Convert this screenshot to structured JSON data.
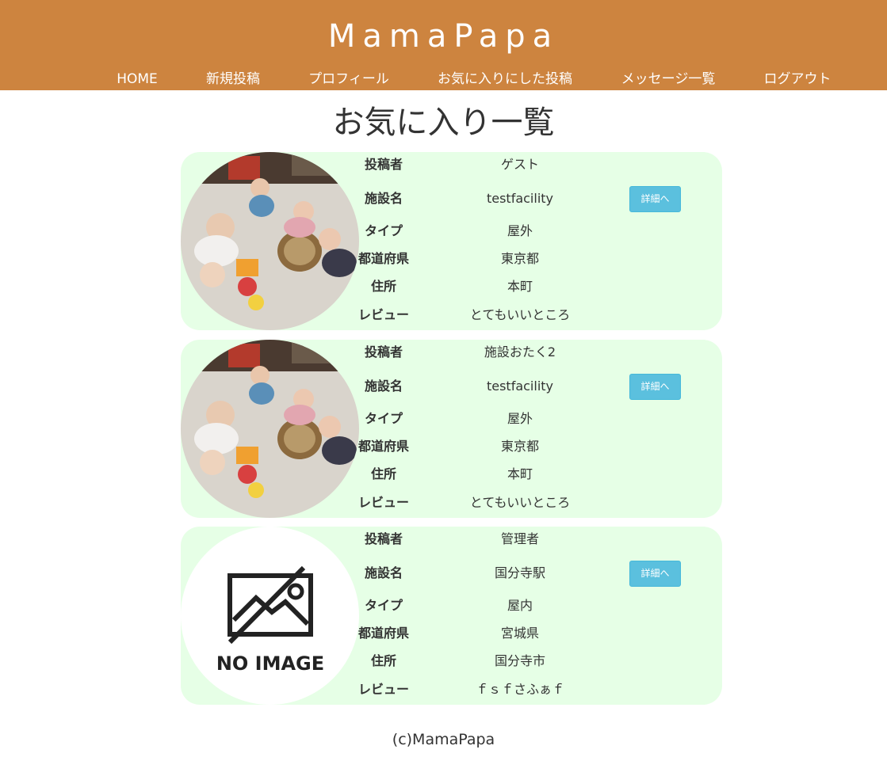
{
  "header": {
    "brand": "MamaPapa",
    "nav": [
      {
        "label": "HOME"
      },
      {
        "label": "新規投稿"
      },
      {
        "label": "プロフィール"
      },
      {
        "label": "お気に入りにした投稿"
      },
      {
        "label": "メッセージ一覧"
      },
      {
        "label": "ログアウト"
      }
    ]
  },
  "page_title": "お気に入り一覧",
  "labels": {
    "poster": "投稿者",
    "facility": "施設名",
    "type": "タイプ",
    "prefecture": "都道府県",
    "address": "住所",
    "review": "レビュー",
    "detail_button": "詳細へ"
  },
  "cards": [
    {
      "image": "photo-babies",
      "poster": "ゲスト",
      "facility": "testfacility",
      "type": "屋外",
      "prefecture": "東京都",
      "address": "本町",
      "review": "とてもいいところ"
    },
    {
      "image": "photo-babies",
      "poster": "施設おたく2",
      "facility": "testfacility",
      "type": "屋外",
      "prefecture": "東京都",
      "address": "本町",
      "review": "とてもいいところ"
    },
    {
      "image": "no-image",
      "no_image_text": "NO IMAGE",
      "poster": "管理者",
      "facility": "国分寺駅",
      "type": "屋内",
      "prefecture": "宮城県",
      "address": "国分寺市",
      "review": "ｆｓｆさふぁｆ"
    }
  ],
  "footer": "(c)MamaPapa",
  "colors": {
    "header_bg": "#cd843f",
    "card_bg": "#e6ffe6",
    "button_bg": "#5bc0de"
  }
}
